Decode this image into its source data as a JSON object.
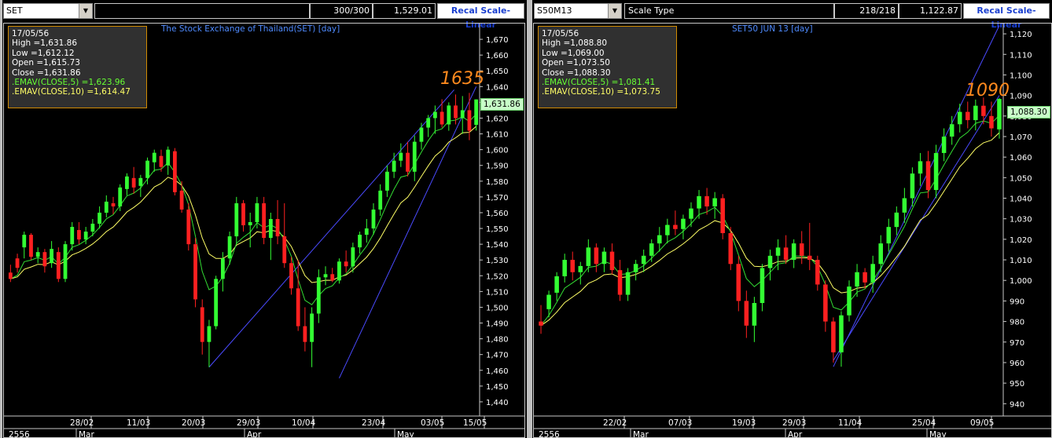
{
  "left": {
    "symbol": "SET",
    "field2": "",
    "count": "300/300",
    "value": "1,529.01",
    "recal": "Recal Scale-Linear",
    "title": "The Stock Exchange of Thailand(SET)  [day]",
    "big_label": "1635",
    "last_value": "1,631.86",
    "info": {
      "date": "17/05/56",
      "high": "High  =1,631.86",
      "low": "Low   =1,612.12",
      "open": "Open  =1,615.73",
      "close": "Close =1,631.86",
      "ema5": ".EMAV(CLOSE,5)   =1,623.96",
      "ema10": ".EMAV(CLOSE,10)   =1,614.47"
    }
  },
  "right": {
    "symbol": "S50M13",
    "field2": "Scale Type",
    "count": "218/218",
    "value": "1,122.87",
    "recal": "Recal Scale-Linear",
    "title": "SET50 JUN 13   [day]",
    "big_label": "1090",
    "last_value": "1,088.30",
    "info": {
      "date": "17/05/56",
      "high": "High  =1,088.80",
      "low": "Low   =1,069.00",
      "open": "Open  =1,073.50",
      "close": "Close =1,088.30",
      "ema5": ".EMAV(CLOSE,5)   =1,081.41",
      "ema10": ".EMAV(CLOSE,10)   =1,073.75"
    }
  },
  "chart_data": [
    {
      "type": "candlestick",
      "title": "The Stock Exchange of Thailand(SET)  [day]",
      "y_ticks": [
        1440,
        1450,
        1460,
        1470,
        1480,
        1490,
        1500,
        1510,
        1520,
        1530,
        1540,
        1550,
        1560,
        1570,
        1580,
        1590,
        1600,
        1610,
        1620,
        1630,
        1640,
        1650,
        1660,
        1670
      ],
      "ylim": [
        1431,
        1680
      ],
      "x_date_labels": [
        "28/02",
        "11/03",
        "20/03",
        "29/03",
        "10/04",
        "23/04",
        "03/05",
        "15/05"
      ],
      "month_labels": [
        "2556",
        "Mar",
        "Apr",
        "May"
      ],
      "colors": {
        "up": "#33ff33",
        "down": "#ff2020",
        "ema5": "#33dd33",
        "ema10": "#ffff66",
        "channel": "#4a4aff"
      },
      "candles": [
        [
          1522,
          1527,
          1516,
          1518
        ],
        [
          1531,
          1534,
          1522,
          1525
        ],
        [
          1538,
          1548,
          1531,
          1546
        ],
        [
          1546,
          1547,
          1530,
          1532
        ],
        [
          1532,
          1538,
          1528,
          1535
        ],
        [
          1535,
          1537,
          1522,
          1526
        ],
        [
          1528,
          1542,
          1525,
          1537
        ],
        [
          1535,
          1538,
          1516,
          1518
        ],
        [
          1518,
          1542,
          1516,
          1540
        ],
        [
          1540,
          1554,
          1536,
          1551
        ],
        [
          1549,
          1554,
          1540,
          1543
        ],
        [
          1543,
          1551,
          1540,
          1548
        ],
        [
          1548,
          1556,
          1545,
          1553
        ],
        [
          1553,
          1564,
          1550,
          1560
        ],
        [
          1560,
          1571,
          1557,
          1567
        ],
        [
          1566,
          1570,
          1559,
          1564
        ],
        [
          1564,
          1578,
          1561,
          1576
        ],
        [
          1575,
          1585,
          1571,
          1583
        ],
        [
          1582,
          1589,
          1572,
          1576
        ],
        [
          1577,
          1584,
          1570,
          1582
        ],
        [
          1582,
          1595,
          1578,
          1593
        ],
        [
          1592,
          1600,
          1586,
          1598
        ],
        [
          1596,
          1600,
          1586,
          1589
        ],
        [
          1590,
          1602,
          1584,
          1600
        ],
        [
          1599,
          1601,
          1571,
          1573
        ],
        [
          1574,
          1580,
          1560,
          1562
        ],
        [
          1562,
          1566,
          1536,
          1540
        ],
        [
          1540,
          1544,
          1500,
          1505
        ],
        [
          1500,
          1505,
          1470,
          1478
        ],
        [
          1478,
          1492,
          1462,
          1488
        ],
        [
          1488,
          1520,
          1486,
          1518
        ],
        [
          1518,
          1535,
          1510,
          1531
        ],
        [
          1531,
          1548,
          1527,
          1545
        ],
        [
          1545,
          1570,
          1540,
          1566
        ],
        [
          1566,
          1568,
          1548,
          1552
        ],
        [
          1552,
          1560,
          1538,
          1554
        ],
        [
          1554,
          1570,
          1550,
          1566
        ],
        [
          1566,
          1570,
          1540,
          1544
        ],
        [
          1544,
          1560,
          1530,
          1556
        ],
        [
          1556,
          1568,
          1540,
          1545
        ],
        [
          1545,
          1566,
          1525,
          1528
        ],
        [
          1528,
          1532,
          1508,
          1512
        ],
        [
          1512,
          1530,
          1485,
          1488
        ],
        [
          1488,
          1500,
          1472,
          1478
        ],
        [
          1478,
          1500,
          1462,
          1496
        ],
        [
          1496,
          1524,
          1490,
          1519
        ],
        [
          1519,
          1526,
          1514,
          1521
        ],
        [
          1521,
          1525,
          1516,
          1517
        ],
        [
          1517,
          1531,
          1515,
          1529
        ],
        [
          1529,
          1536,
          1522,
          1526
        ],
        [
          1526,
          1541,
          1522,
          1538
        ],
        [
          1538,
          1548,
          1534,
          1546
        ],
        [
          1546,
          1556,
          1541,
          1550
        ],
        [
          1550,
          1566,
          1546,
          1562
        ],
        [
          1562,
          1578,
          1558,
          1574
        ],
        [
          1574,
          1590,
          1570,
          1586
        ],
        [
          1586,
          1598,
          1582,
          1593
        ],
        [
          1593,
          1604,
          1589,
          1598
        ],
        [
          1598,
          1605,
          1583,
          1586
        ],
        [
          1586,
          1609,
          1580,
          1605
        ],
        [
          1605,
          1617,
          1600,
          1614
        ],
        [
          1614,
          1622,
          1608,
          1620
        ],
        [
          1620,
          1628,
          1610,
          1624
        ],
        [
          1624,
          1632,
          1614,
          1616
        ],
        [
          1616,
          1630,
          1612,
          1628
        ],
        [
          1628,
          1635,
          1616,
          1620
        ],
        [
          1620,
          1634,
          1610,
          1625
        ],
        [
          1625,
          1636,
          1606,
          1612
        ],
        [
          1615.73,
          1631.86,
          1612.12,
          1631.86
        ]
      ]
    },
    {
      "type": "candlestick",
      "title": "SET50 JUN 13   [day]",
      "y_ticks": [
        940,
        950,
        960,
        970,
        980,
        990,
        1000,
        1010,
        1020,
        1030,
        1040,
        1050,
        1060,
        1070,
        1080,
        1090,
        1100,
        1110,
        1120
      ],
      "ylim": [
        934,
        1125
      ],
      "x_date_labels": [
        "22/02",
        "07/03",
        "19/03",
        "29/03",
        "11/04",
        "25/04",
        "09/05"
      ],
      "month_labels": [
        "2556",
        "Mar",
        "Apr",
        "May"
      ],
      "colors": {
        "up": "#33ff33",
        "down": "#ff2020",
        "ema5": "#33dd33",
        "ema10": "#ffff66",
        "channel": "#4a4aff"
      },
      "candles": [
        [
          980,
          988,
          974,
          978
        ],
        [
          986,
          995,
          982,
          993
        ],
        [
          994,
          1004,
          990,
          1002
        ],
        [
          1002,
          1013,
          999,
          1010
        ],
        [
          1010,
          1014,
          1000,
          1004
        ],
        [
          1004,
          1009,
          998,
          1007
        ],
        [
          1007,
          1020,
          1004,
          1016
        ],
        [
          1016,
          1018,
          1004,
          1008
        ],
        [
          1008,
          1016,
          1004,
          1014
        ],
        [
          1014,
          1018,
          1003,
          1005
        ],
        [
          1005,
          1010,
          990,
          993
        ],
        [
          993,
          1006,
          990,
          1004
        ],
        [
          1004,
          1010,
          1000,
          1008
        ],
        [
          1008,
          1015,
          1004,
          1012
        ],
        [
          1012,
          1020,
          1009,
          1018
        ],
        [
          1018,
          1026,
          1014,
          1022
        ],
        [
          1022,
          1030,
          1018,
          1027
        ],
        [
          1027,
          1034,
          1022,
          1025
        ],
        [
          1025,
          1032,
          1020,
          1030
        ],
        [
          1030,
          1038,
          1026,
          1035
        ],
        [
          1035,
          1044,
          1030,
          1041
        ],
        [
          1041,
          1045,
          1032,
          1036
        ],
        [
          1036,
          1043,
          1030,
          1040
        ],
        [
          1040,
          1042,
          1020,
          1023
        ],
        [
          1023,
          1026,
          1005,
          1008
        ],
        [
          1008,
          1012,
          985,
          990
        ],
        [
          990,
          995,
          972,
          978
        ],
        [
          978,
          992,
          970,
          989
        ],
        [
          989,
          1008,
          985,
          1006
        ],
        [
          1006,
          1015,
          1000,
          1012
        ],
        [
          1012,
          1020,
          1005,
          1016
        ],
        [
          1016,
          1022,
          1008,
          1010
        ],
        [
          1010,
          1020,
          1006,
          1018
        ],
        [
          1018,
          1024,
          1008,
          1012
        ],
        [
          1012,
          1028,
          1005,
          1010
        ],
        [
          1010,
          1012,
          995,
          998
        ],
        [
          998,
          1000,
          975,
          980
        ],
        [
          980,
          982,
          960,
          965
        ],
        [
          965,
          985,
          958,
          983
        ],
        [
          983,
          1000,
          980,
          997
        ],
        [
          997,
          1008,
          992,
          1004
        ],
        [
          1004,
          1006,
          996,
          999
        ],
        [
          999,
          1012,
          994,
          1008
        ],
        [
          1008,
          1022,
          1004,
          1018
        ],
        [
          1018,
          1030,
          1014,
          1026
        ],
        [
          1026,
          1036,
          1022,
          1033
        ],
        [
          1033,
          1045,
          1028,
          1040
        ],
        [
          1040,
          1055,
          1036,
          1052
        ],
        [
          1052,
          1062,
          1046,
          1058
        ],
        [
          1058,
          1063,
          1040,
          1044
        ],
        [
          1044,
          1066,
          1040,
          1062
        ],
        [
          1062,
          1074,
          1058,
          1070
        ],
        [
          1070,
          1080,
          1066,
          1076
        ],
        [
          1076,
          1086,
          1072,
          1082
        ],
        [
          1082,
          1087,
          1074,
          1078
        ],
        [
          1078,
          1088,
          1073,
          1085
        ],
        [
          1085,
          1089,
          1076,
          1080
        ],
        [
          1080,
          1087,
          1070,
          1074
        ],
        [
          1073.5,
          1088.8,
          1069,
          1088.3
        ]
      ]
    }
  ]
}
